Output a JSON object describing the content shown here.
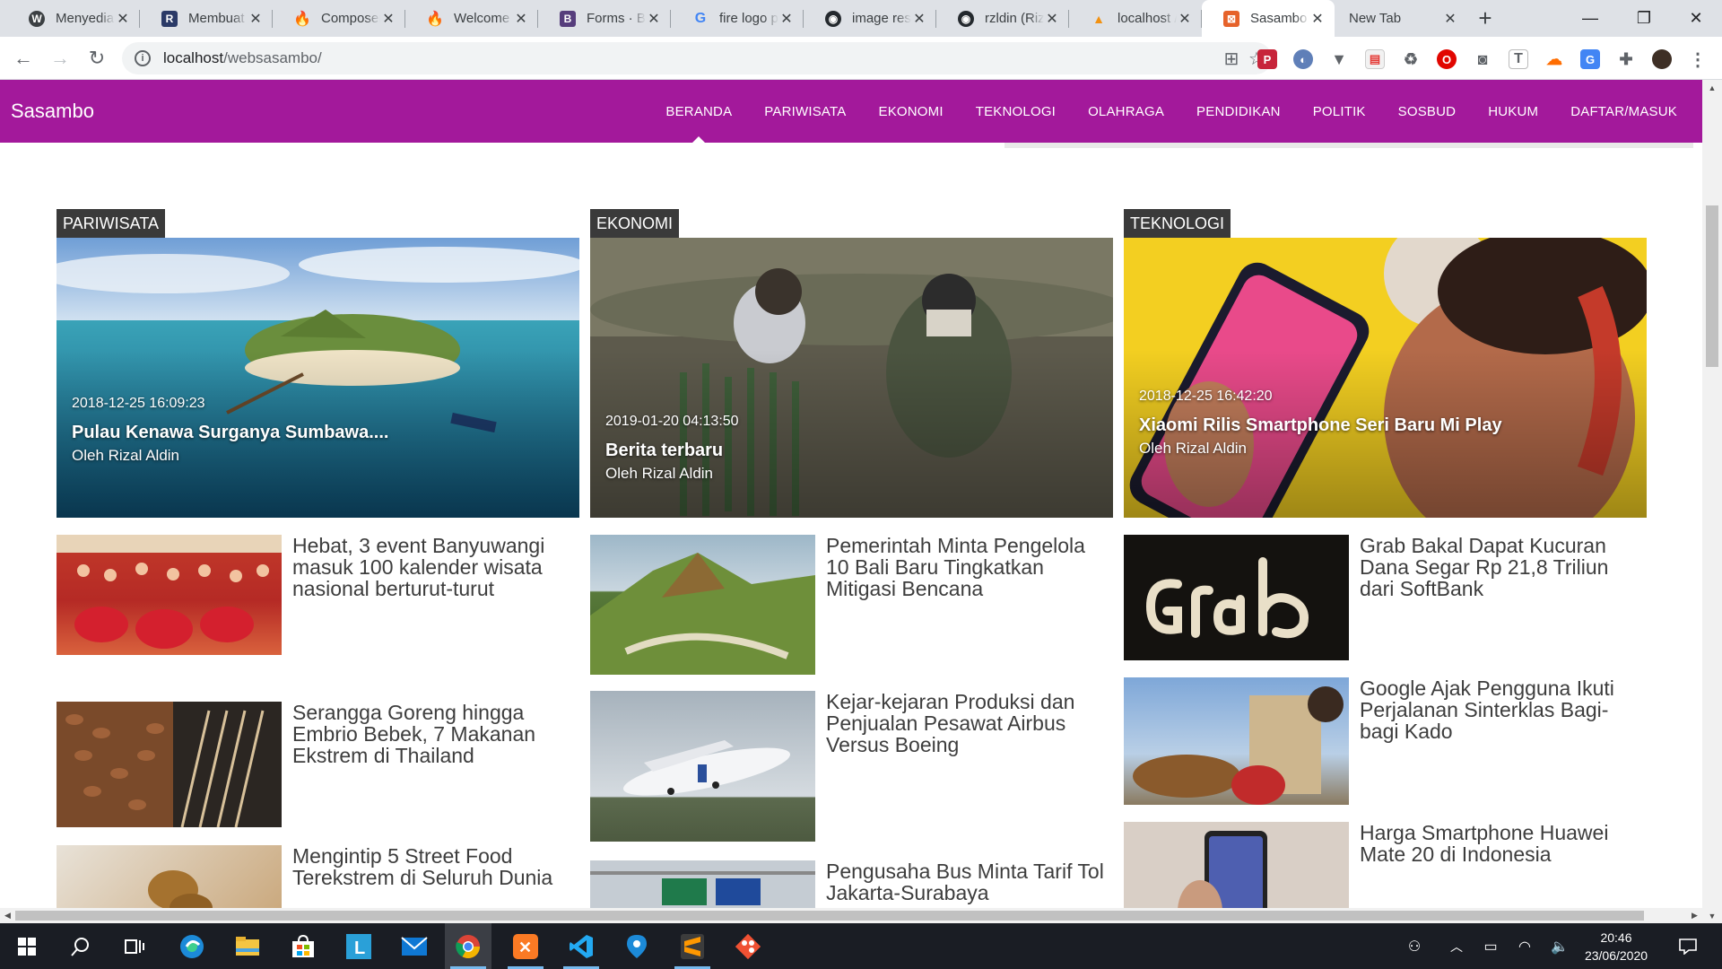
{
  "browser": {
    "tabs": [
      {
        "label": "Menyediakan",
        "favicon": "wordpress-icon",
        "color": "#3c4043"
      },
      {
        "label": "Membuat",
        "favicon": "r-icon",
        "color": "#2b3a67"
      },
      {
        "label": "Composer",
        "favicon": "fire-icon",
        "color": "#f4511e"
      },
      {
        "label": "Welcome",
        "favicon": "fire-icon",
        "color": "#f4511e"
      },
      {
        "label": "Forms · Bo",
        "favicon": "bootstrap-icon",
        "color": "#563d7c"
      },
      {
        "label": "fire logo p",
        "favicon": "google-icon",
        "color": "#4285f4"
      },
      {
        "label": "image resi",
        "favicon": "github-icon",
        "color": "#24292e"
      },
      {
        "label": "rzldin (Riz",
        "favicon": "github-icon",
        "color": "#24292e"
      },
      {
        "label": "localhost /",
        "favicon": "phpmyadmin-icon",
        "color": "#f29111"
      },
      {
        "label": "Sasambo",
        "favicon": "sasambo-icon",
        "color": "#e6622a"
      },
      {
        "label": "New Tab",
        "favicon": "",
        "color": ""
      }
    ],
    "active_tab": 9,
    "url_host": "localhost",
    "url_path": "/websasambo/"
  },
  "site": {
    "brand": "Sasambo",
    "brand_color": "#a3199b",
    "menu": [
      "BERANDA",
      "PARIWISATA",
      "EKONOMI",
      "TEKNOLOGI",
      "OLAHRAGA",
      "PENDIDIKAN",
      "POLITIK",
      "SOSBUD",
      "HUKUM",
      "DAFTAR/MASUK"
    ],
    "active_menu": 0
  },
  "columns": [
    {
      "category": "PARIWISATA",
      "hero": {
        "date": "2018-12-25 16:09:23",
        "title": "Pulau Kenawa Surganya Sumbawa....",
        "author": "Oleh Rizal Aldin"
      },
      "items": [
        {
          "title": "Hebat, 3 event Banyuwangi masuk 100 kalender wisata nasional berturut-turut"
        },
        {
          "title": "Serangga Goreng hingga Embrio Bebek, 7 Makanan Ekstrem di Thailand"
        },
        {
          "title": "Mengintip 5 Street Food Terekstrem di Seluruh Dunia"
        }
      ]
    },
    {
      "category": "EKONOMI",
      "hero": {
        "date": "2019-01-20 04:13:50",
        "title": "Berita terbaru",
        "author": "Oleh Rizal Aldin"
      },
      "items": [
        {
          "title": "Pemerintah Minta Pengelola 10 Bali Baru Tingkatkan Mitigasi Bencana"
        },
        {
          "title": "Kejar-kejaran Produksi dan Penjualan Pesawat Airbus Versus Boeing"
        },
        {
          "title": "Pengusaha Bus Minta Tarif Tol Jakarta-Surabaya"
        }
      ]
    },
    {
      "category": "TEKNOLOGI",
      "hero": {
        "date": "2018-12-25 16:42:20",
        "title": "Xiaomi Rilis Smartphone Seri Baru Mi Play",
        "author": "Oleh Rizal Aldin"
      },
      "items": [
        {
          "title": "Grab Bakal Dapat Kucuran Dana Segar Rp 21,8 Triliun dari SoftBank"
        },
        {
          "title": "Google Ajak Pengguna Ikuti Perjalanan Sinterklas Bagi-bagi Kado"
        },
        {
          "title": "Harga Smartphone Huawei Mate 20 di Indonesia"
        }
      ]
    }
  ],
  "taskbar": {
    "apps": [
      "windows-start-icon",
      "search-icon",
      "task-view-icon",
      "edge-icon",
      "file-explorer-icon",
      "store-icon",
      "l-app-icon",
      "mail-icon",
      "chrome-icon",
      "xampp-icon",
      "vscode-icon",
      "maps-icon",
      "sublime-icon",
      "git-icon"
    ],
    "time": "20:46",
    "date": "23/06/2020"
  }
}
